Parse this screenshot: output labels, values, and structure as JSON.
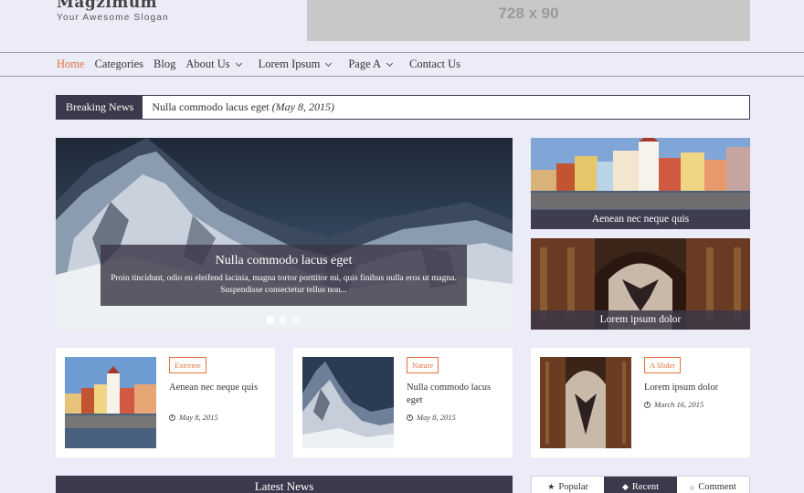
{
  "header": {
    "site_title": "Magzimum",
    "slogan": "Your Awesome Slogan",
    "ad_text": "728 x 90"
  },
  "nav": {
    "items": [
      {
        "label": "Home",
        "active": true,
        "dropdown": false
      },
      {
        "label": "Categories",
        "active": false,
        "dropdown": false
      },
      {
        "label": "Blog",
        "active": false,
        "dropdown": false
      },
      {
        "label": "About Us",
        "active": false,
        "dropdown": true
      },
      {
        "label": "Lorem Ipsum",
        "active": false,
        "dropdown": true
      },
      {
        "label": "Page A",
        "active": false,
        "dropdown": true
      },
      {
        "label": "Contact Us",
        "active": false,
        "dropdown": false
      }
    ]
  },
  "breaking": {
    "label": "Breaking News",
    "headline": "Nulla commodo lacus eget",
    "date": "(May 8, 2015)"
  },
  "slider": {
    "title": "Nulla commodo lacus eget",
    "excerpt": "Proin tincidunt, odio eu eleifend lacinia, magna tortor porttitor mi, quis finibus nulla eros ut magna. Suspendisse consectetur tellus non..."
  },
  "side_cards": [
    {
      "caption": "Aenean nec neque quis"
    },
    {
      "caption": "Lorem ipsum dolor"
    }
  ],
  "posts": [
    {
      "tag": "Extreme",
      "title": "Aenean nec neque quis",
      "date": "May 8, 2015"
    },
    {
      "tag": "Nature",
      "title": "Nulla commodo lacus eget",
      "date": "May 8, 2015"
    },
    {
      "tag": "A Slider",
      "title": "Lorem ipsum dolor",
      "date": "March 16, 2015"
    }
  ],
  "latest": {
    "title": "Latest News"
  },
  "tabs": [
    {
      "label": "Popular",
      "icon": "star-icon",
      "active": false
    },
    {
      "label": "Recent",
      "icon": "tag-icon",
      "active": true
    },
    {
      "label": "Comment",
      "icon": "comment-icon",
      "active": false
    }
  ],
  "colors": {
    "accent": "#e8703a",
    "dark": "#3b3a4d",
    "background": "#ecebf8"
  }
}
